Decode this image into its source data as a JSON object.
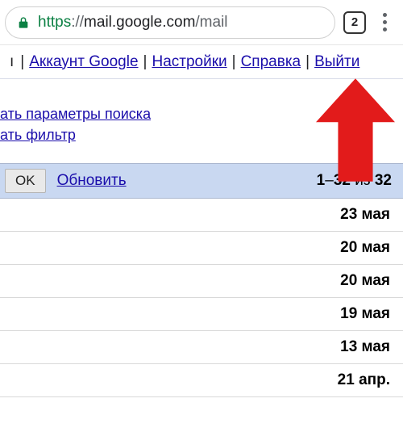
{
  "browser": {
    "url_scheme": "https",
    "url_sep": "://",
    "url_host": "mail.google.com",
    "url_path": "/mail",
    "tab_count": "2"
  },
  "toplinks": {
    "prefix": "ı",
    "divider": " | ",
    "account": "Аккаунт Google",
    "settings": "Настройки",
    "help": "Справка",
    "signout": "Выйти"
  },
  "search": {
    "show_params": "ать параметры поиска",
    "create_filter": "ать фильтр"
  },
  "toolbar": {
    "ok_label": "OK",
    "refresh_label": "Обновить",
    "page_from": "1",
    "page_dash": "–",
    "page_to": "32",
    "page_of": " из ",
    "page_total": "32"
  },
  "rows": [
    {
      "date": "23 мая"
    },
    {
      "date": "20 мая"
    },
    {
      "date": "20 мая"
    },
    {
      "date": "19 мая"
    },
    {
      "date": "13 мая"
    },
    {
      "date": "21 апр."
    }
  ],
  "arrow_color": "#e21b1b"
}
